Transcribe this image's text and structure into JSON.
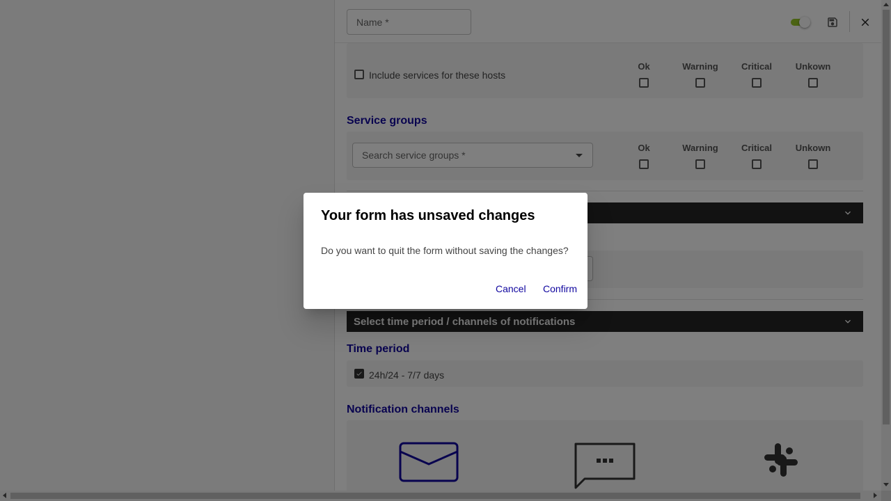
{
  "header": {
    "name_placeholder": "Name *"
  },
  "hosts_block": {
    "include_services_label": "Include services for these hosts"
  },
  "states": [
    "Ok",
    "Warning",
    "Critical",
    "Unkown"
  ],
  "service_groups": {
    "title": "Service groups",
    "search_placeholder": "Search service groups *"
  },
  "time_section": {
    "accordion_label": "Select time period / channels of notifications",
    "time_period_title": "Time period",
    "time_period_option": "24h/24 - 7/7 days",
    "notification_channels_title": "Notification channels"
  },
  "dialog": {
    "title": "Your form has unsaved changes",
    "message": "Do you want to quit the form without saving the changes?",
    "cancel_label": "Cancel",
    "confirm_label": "Confirm"
  },
  "colors": {
    "accent": "#10069f",
    "toggle_on": "#84bd00",
    "accordion_bg": "#242424"
  }
}
